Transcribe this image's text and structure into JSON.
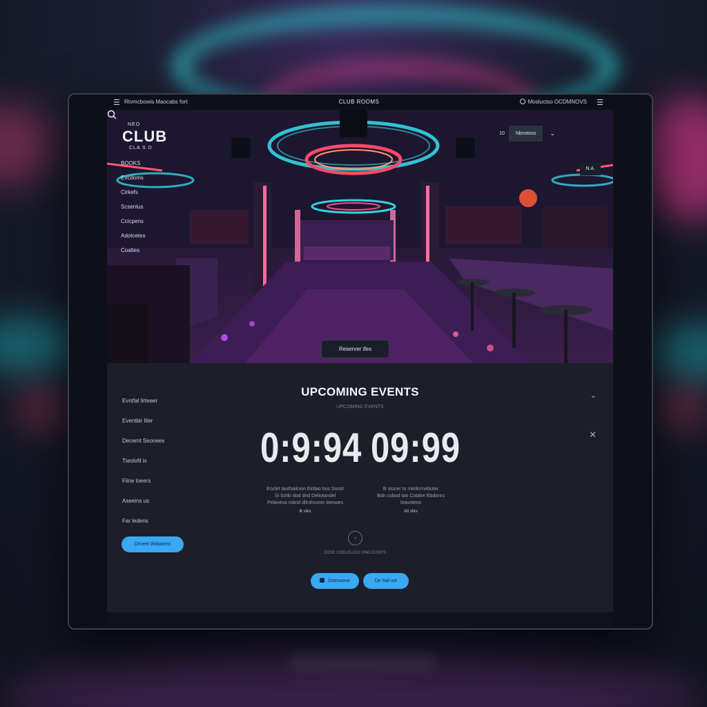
{
  "topbar": {
    "menu_icon": "hamburger-icon",
    "site_name": "Rtvmcbowis Maocabs fort",
    "title": "CLUB ROOMS",
    "right_link": "Mosluctso OCDMNOVS",
    "right_icon": "globe-icon"
  },
  "hero": {
    "logo_top": "NEO",
    "logo_main": "CLUB",
    "logo_sub": "CLA S D",
    "nav": [
      "BOOKS",
      "Evcdoms",
      "Cirkefs",
      "Scsenlus",
      "Ccicpens",
      "Adotcetes",
      "Coaltes"
    ],
    "top_right_tag": "10",
    "top_right_box": "Nbnotoss",
    "search_icon": "search-icon",
    "badge": "N.A.",
    "reserve_button": "Reserver ifes"
  },
  "events": {
    "title": "UPCOMING EVENTS",
    "subtitle": "UPCOMING EVENTS",
    "nav": [
      "Evntfal lirteaer",
      "Eventbir liter",
      "Decemt Seonees",
      "Tteolvfil is",
      "Fline loeers",
      "Aseeins us",
      "Far ledens"
    ],
    "subscribe_button": "Drneet Wdwoent",
    "timer_left": "0:9:94",
    "timer_right": "09:99",
    "desc_left": [
      "Eoclet tauthailcion Eirtlao bos Sonst",
      "Si Sotlo dod dnd Deliotandel",
      "Pelaveva mbnd dllrshvvom leeooes"
    ],
    "desc_left_small": "ilt sfes",
    "desc_right": [
      "B stocer to mirdicrnebuter",
      "Bdn cobod tao Cotalre Ebdonrs",
      "leavoteos"
    ],
    "desc_right_small": "Ati sfes",
    "circle_label": "›",
    "circle_caption": "EDSE OSELELCIO ONO EONTS",
    "btn_a": "Doerwove",
    "btn_b": "De ltail ise"
  },
  "colors": {
    "accent": "#3aa8f2",
    "neon_cyan": "#2fd3d8",
    "neon_pink": "#ff3f8f",
    "panel": "#1c1f2a"
  }
}
